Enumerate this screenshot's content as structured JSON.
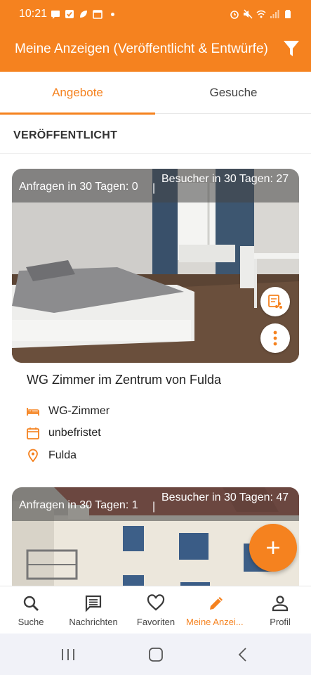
{
  "status_bar": {
    "time": "10:21",
    "left_icons": [
      "message-icon",
      "check-icon",
      "leaf-icon",
      "calendar-icon"
    ],
    "right_icons": [
      "alarm-icon",
      "mute-icon",
      "wifi-icon",
      "signal-icon",
      "battery-icon"
    ]
  },
  "app_bar": {
    "title": "Meine Anzeigen (Veröffentlicht & Entwürfe)",
    "filter_icon": "filter-icon"
  },
  "tabs": [
    {
      "label": "Angebote",
      "active": true
    },
    {
      "label": "Gesuche",
      "active": false
    }
  ],
  "section_label": "VERÖFFENTLICHT",
  "listings": [
    {
      "requests": "Anfragen in 30 Tagen: 0",
      "visitors": "Besucher in 30 Tagen: 27",
      "title": "WG Zimmer im Zentrum von Fulda",
      "type": "WG-Zimmer",
      "duration": "unbefristet",
      "city": "Fulda"
    },
    {
      "requests": "Anfragen in 30 Tagen: 1",
      "visitors": "Besucher in 30 Tagen: 47"
    }
  ],
  "bottom_nav": [
    {
      "label": "Suche",
      "icon": "search-icon"
    },
    {
      "label": "Nachrichten",
      "icon": "chat-icon"
    },
    {
      "label": "Favoriten",
      "icon": "heart-icon"
    },
    {
      "label": "Meine Anzei...",
      "icon": "pencil-icon",
      "active": true
    },
    {
      "label": "Profil",
      "icon": "person-icon"
    }
  ],
  "colors": {
    "accent": "#f5821f",
    "text": "#222222",
    "system_nav": "#f1f2f8"
  }
}
